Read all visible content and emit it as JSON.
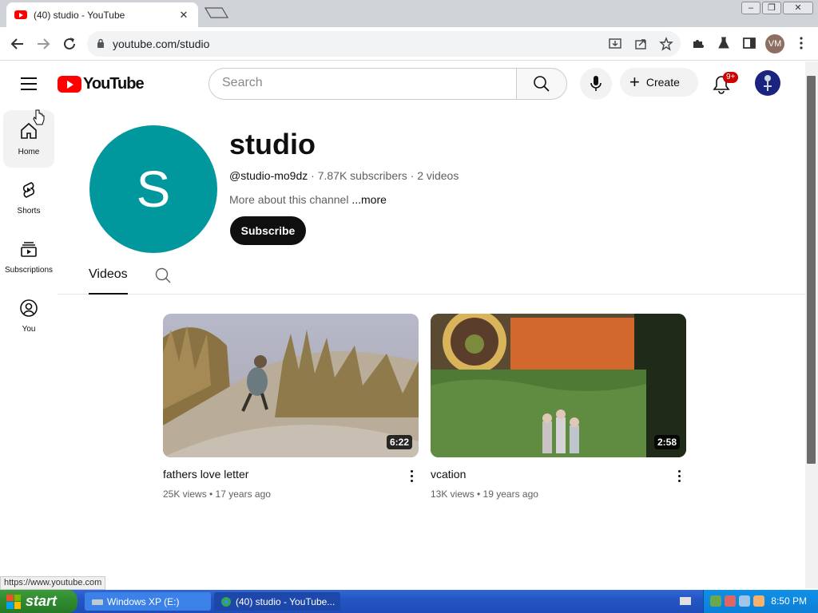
{
  "browser": {
    "tab_title": "(40) studio - YouTube",
    "tab_close": "✕",
    "url": "youtube.com/studio",
    "profile_initials": "VM",
    "status_url": "https://www.youtube.com"
  },
  "header": {
    "logo_text": "YouTube",
    "search_placeholder": "Search",
    "create_label": "Create",
    "notification_count": "9+"
  },
  "guide": [
    {
      "label": "Home",
      "icon": "home-icon"
    },
    {
      "label": "Shorts",
      "icon": "shorts-icon"
    },
    {
      "label": "Subscriptions",
      "icon": "subscriptions-icon"
    },
    {
      "label": "You",
      "icon": "you-icon"
    }
  ],
  "channel": {
    "avatar_letter": "S",
    "name": "studio",
    "handle": "@studio-mo9dz",
    "subscribers": " · 7.87K subscribers · 2 videos",
    "about": "More about this channel ",
    "more": "...more",
    "subscribe_label": "Subscribe",
    "tab_videos": "Videos"
  },
  "videos": [
    {
      "title": "fathers love letter",
      "meta": "25K views • 17 years ago",
      "duration": "6:22"
    },
    {
      "title": "vcation",
      "meta": "13K views • 19 years ago",
      "duration": "2:58"
    }
  ],
  "taskbar": {
    "start_label": "start",
    "buttons": [
      "Windows XP (E:)",
      "(40) studio - YouTube..."
    ],
    "time": "8:50 PM"
  },
  "colors": {
    "youtube_red": "#ff0000",
    "channel_avatar": "#00979d",
    "subscribe_bg": "#0f0f0f",
    "xp_taskbar": "#2456c4",
    "xp_start": "#2f8a2f"
  }
}
